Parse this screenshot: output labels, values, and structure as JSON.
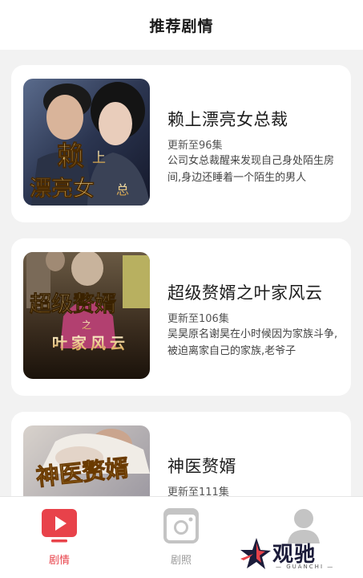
{
  "header": {
    "title": "推荐剧情"
  },
  "dramas": [
    {
      "title": "赖上漂亮女总裁",
      "episodes": "更新至96集",
      "description": "公司女总裁醒来发现自己身处陌生房间,身边还睡着一个陌生的男人",
      "poster_text": "赖上漂亮女总"
    },
    {
      "title": "超级赘婿之叶家风云",
      "episodes": "更新至106集",
      "description": "吴昊原名谢昊在小时候因为家族斗争,被迫离家自己的家族,老爷子",
      "poster_text": "超级赘婿之叶家风云"
    },
    {
      "title": "神医赘婿",
      "episodes": "更新至111集",
      "description": "",
      "poster_text": "神医赘婿"
    }
  ],
  "tabbar": {
    "tabs": [
      {
        "label": "剧情",
        "icon": "play-icon",
        "active": true
      },
      {
        "label": "剧照",
        "icon": "camera-icon",
        "active": false
      },
      {
        "label": "",
        "icon": "user-icon",
        "active": false
      }
    ]
  },
  "watermark": {
    "text": "观驰",
    "subtext": "— GUANCHI —"
  },
  "colors": {
    "accent": "#e8424a",
    "inactive": "#c4c4c4",
    "background": "#f2f2f2"
  }
}
